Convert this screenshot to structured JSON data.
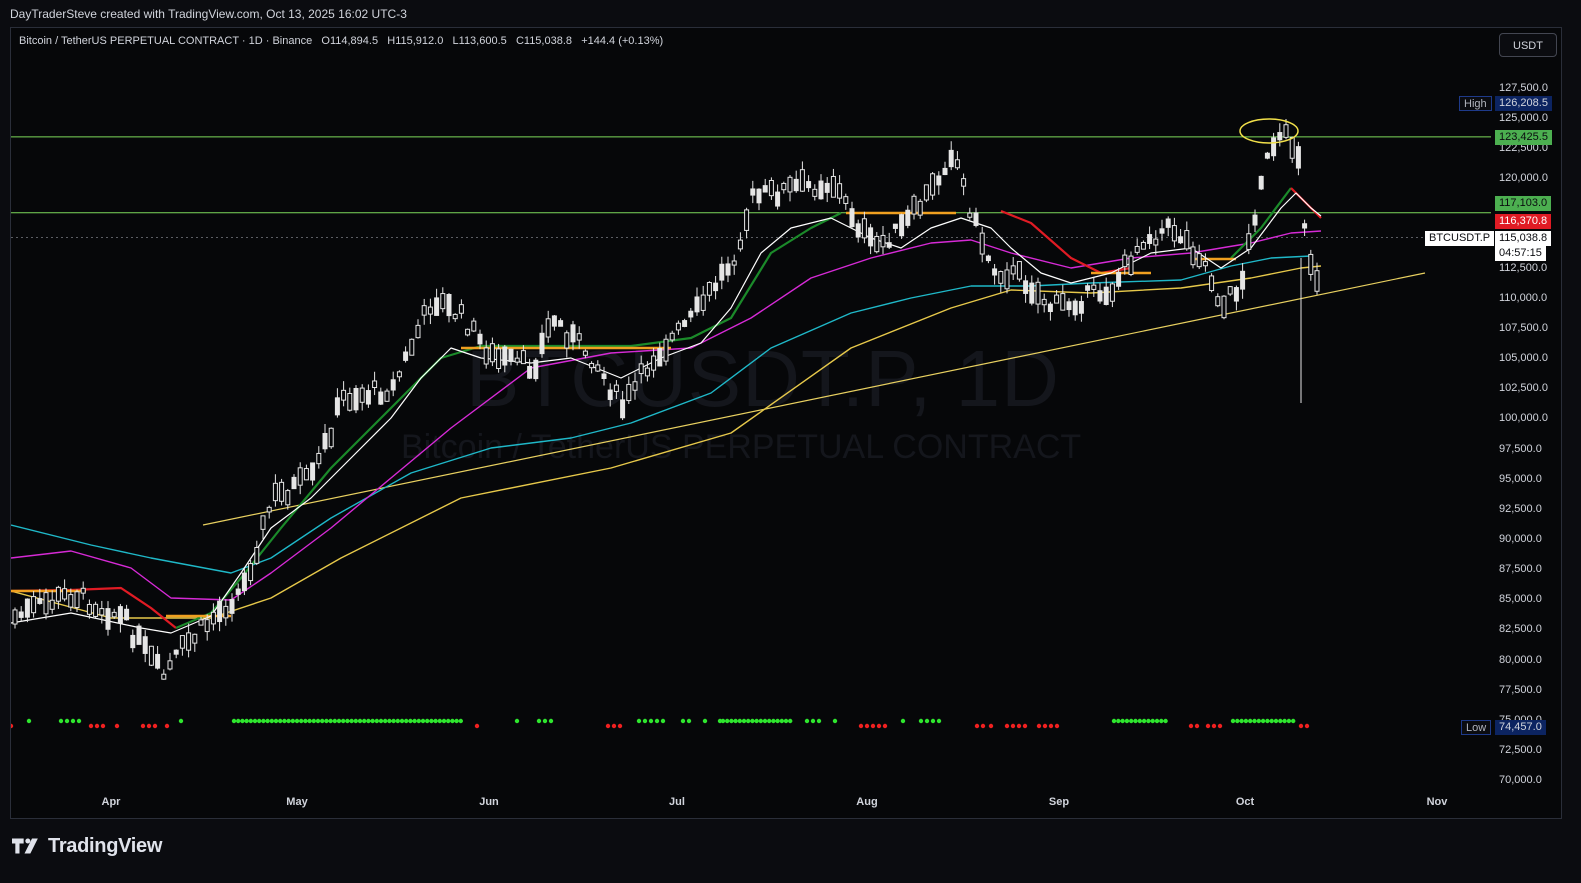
{
  "credit": "DayTraderSteve created with TradingView.com, Oct 13, 2025 16:02 UTC-3",
  "legend": {
    "symbol": "Bitcoin / TetherUS PERPETUAL CONTRACT · 1D · Binance",
    "open_label": "O",
    "open": "114,894.5",
    "high_label": "H",
    "high": "115,912.0",
    "low_label": "L",
    "low": "113,600.5",
    "close_label": "C",
    "close": "115,038.8",
    "change": "+144.4 (+0.13%)"
  },
  "currency_button": "USDT",
  "watermark": {
    "ticker": "BTCUSDT.P, 1D",
    "name": "Bitcoin / TetherUS PERPETUAL CONTRACT"
  },
  "x_axis_labels": [
    "Apr",
    "May",
    "Jun",
    "Jul",
    "Aug",
    "Sep",
    "Oct",
    "Nov"
  ],
  "y_axis_labels": [
    "127,500.0",
    "125,000.0",
    "122,500.0",
    "120,000.0",
    "112,500.0",
    "110,000.0",
    "107,500.0",
    "105,000.0",
    "102,500.0",
    "100,000.0",
    "97,500.0",
    "95,000.0",
    "92,500.0",
    "90,000.0",
    "87,500.0",
    "85,000.0",
    "82,500.0",
    "80,000.0",
    "77,500.0",
    "75,000.0",
    "72,500.0",
    "70,000.0"
  ],
  "price_tags": {
    "high_label": "High",
    "high_value": "126,208.5",
    "resistance_1": "123,425.5",
    "resistance_2": "117,103.0",
    "ma_value": "116,370.8",
    "symbol_tag": "BTCUSDT.P",
    "last_price": "115,038.8",
    "countdown": "04:57:15",
    "low_label": "Low",
    "low_value": "74,457.0"
  },
  "colors": {
    "background": "#060709",
    "candle": "#e6e6e6",
    "ma_fast": "#ffffff",
    "ma_trend_up": "#1b8a2a",
    "ma_trend_down": "#e01b24",
    "ma_magenta": "#d62ad6",
    "ma_cyan": "#1fb8c8",
    "ma_yellow": "#e6c84a",
    "trendline": "#e8d060",
    "horizontal_level": "#7cd85a",
    "flat_segment": "#f0a020",
    "dot_green": "#2ee62e",
    "dot_red": "#f02020"
  },
  "brand": "TradingView"
}
